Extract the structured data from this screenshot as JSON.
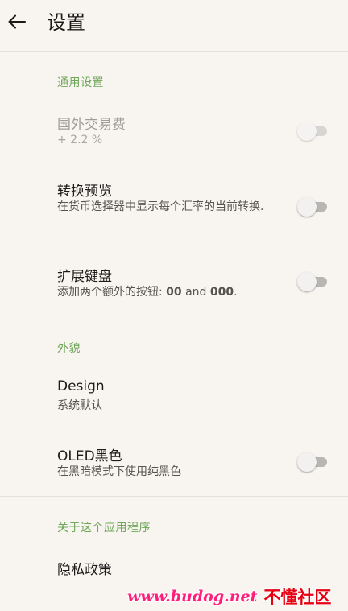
{
  "appbar": {
    "title": "设置",
    "back_icon": "arrow-back-icon"
  },
  "sections": {
    "general": {
      "header": "通用设置"
    },
    "appearance": {
      "header": "外貌"
    },
    "about": {
      "header": "关于这个应用程序"
    }
  },
  "settings": {
    "foreign_fee": {
      "title": "国外交易费",
      "subtitle": "+ 2.2 %",
      "enabled": false,
      "toggle_on": false
    },
    "conversion_preview": {
      "title": "转换预览",
      "subtitle": "在货币选择器中显示每个汇率的当前转换.",
      "toggle_on": false
    },
    "extended_keyboard": {
      "title": "扩展键盘",
      "subtitle_prefix": "添加两个额外的按钮: ",
      "subtitle_bold_1": "00",
      "subtitle_mid": " and ",
      "subtitle_bold_2": "000",
      "subtitle_suffix": ".",
      "toggle_on": false
    },
    "design": {
      "title": "Design",
      "subtitle": "系统默认"
    },
    "oled_black": {
      "title": "OLED黑色",
      "subtitle": "在黑暗模式下使用纯黑色",
      "toggle_on": false
    },
    "privacy_policy": {
      "title": "隐私政策"
    }
  },
  "watermark": {
    "url": "www.budog.net",
    "text": "不懂社区"
  },
  "colors": {
    "accent": "#6fa65a",
    "background": "#f8f5f0",
    "watermark_url": "#ff1f7a",
    "watermark_text": "#e60012"
  }
}
